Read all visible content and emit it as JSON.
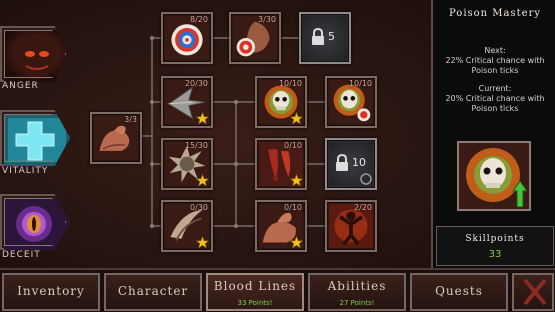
{
  "categories": [
    {
      "name": "anger",
      "label": "ANGER"
    },
    {
      "name": "vitality",
      "label": "VITALITY"
    },
    {
      "name": "deceit",
      "label": "DECEIT"
    }
  ],
  "nodes": {
    "target": "8/20",
    "shield_target": "3/30",
    "locked_top": "5",
    "arm": "3/3",
    "arrowhead": "20/30",
    "skull1": "10/10",
    "skull2": "10/10",
    "spiked_ball": "15/30",
    "blood": "0/10",
    "locked_mid": "10",
    "claw": "0/30",
    "flex_arm": "0/10",
    "rage_man": "2/20"
  },
  "panel": {
    "title": "Poison Mastery",
    "next_label": "Next:",
    "next_text": [
      "22% Critical chance with",
      "Poison ticks"
    ],
    "current_label": "Current:",
    "current_text": [
      "20% Critical chance with",
      "Poison ticks"
    ],
    "skillpoints_label": "Skillpoints",
    "skillpoints_value": "33"
  },
  "tabs": [
    {
      "name": "inventory",
      "label": "Inventory",
      "sub": ""
    },
    {
      "name": "character",
      "label": "Character",
      "sub": ""
    },
    {
      "name": "blood-lines",
      "label": "Blood Lines",
      "sub": "33 Points!"
    },
    {
      "name": "abilities",
      "label": "Abilities",
      "sub": "27 Points!"
    },
    {
      "name": "quests",
      "label": "Quests",
      "sub": ""
    }
  ],
  "colors": {
    "accent_green": "#74d14a",
    "frame": "#7d6a63",
    "blood": "#8a2a1e"
  }
}
